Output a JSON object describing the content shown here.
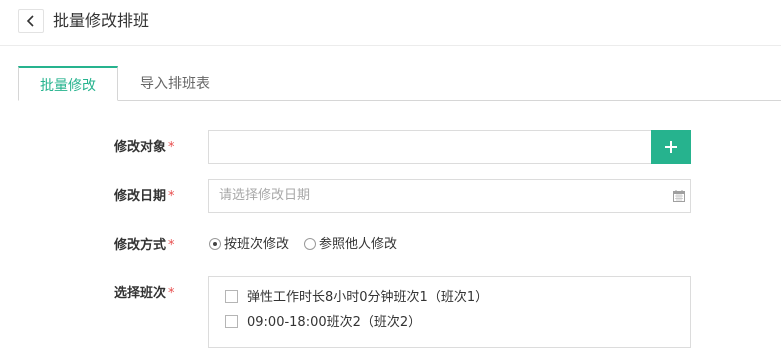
{
  "header": {
    "title": "批量修改排班"
  },
  "tabs": [
    {
      "label": "批量修改",
      "active": true
    },
    {
      "label": "导入排班表",
      "active": false
    }
  ],
  "form": {
    "required_mark": "*",
    "target": {
      "label": "修改对象",
      "value": ""
    },
    "date": {
      "label": "修改日期",
      "placeholder": "请选择修改日期"
    },
    "method": {
      "label": "修改方式",
      "options": [
        {
          "label": "按班次修改",
          "selected": true
        },
        {
          "label": "参照他人修改",
          "selected": false
        }
      ]
    },
    "shift": {
      "label": "选择班次",
      "options": [
        {
          "label": "弹性工作时长8小时0分钟班次1（班次1）",
          "checked": false
        },
        {
          "label": "09:00-18:00班次2（班次2）",
          "checked": false
        }
      ]
    }
  },
  "colors": {
    "accent": "#26b38e",
    "required": "#e84e4e"
  },
  "icons": {
    "back": "chevron-left-icon",
    "add": "plus-icon",
    "calendar": "calendar-icon"
  }
}
